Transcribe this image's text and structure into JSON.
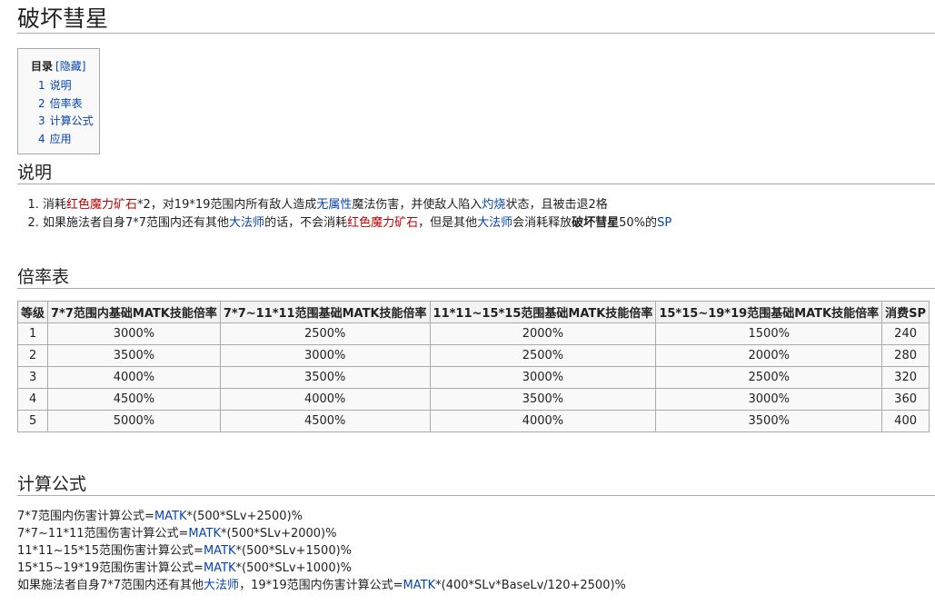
{
  "title": "破坏彗星",
  "toc": {
    "title": "目录",
    "hide_label": "[隐藏]",
    "items": [
      {
        "num": "1",
        "label": "说明"
      },
      {
        "num": "2",
        "label": "倍率表"
      },
      {
        "num": "3",
        "label": "计算公式"
      },
      {
        "num": "4",
        "label": "应用"
      }
    ]
  },
  "section_desc": {
    "heading": "说明",
    "line1": {
      "p1": "消耗",
      "red_ore": "红色魔力矿石",
      "p2": "*2，对19*19范围内所有敌人造成",
      "no_attr": "无属性",
      "p3": "魔法伤害，并使敌人陷入",
      "burn": "灼烧",
      "p4": "状态，且被击退2格"
    },
    "line2": {
      "p1": "如果施法者自身7*7范围内还有其他",
      "wizard1": "大法师",
      "p2": "的话，不会消耗",
      "red_ore": "红色魔力矿石",
      "p3": "，但是其他",
      "wizard2": "大法师",
      "p4": "会消耗释放",
      "skill_bold": "破坏彗星",
      "p5": "50%的",
      "sp": "SP"
    }
  },
  "section_table": {
    "heading": "倍率表",
    "headers": [
      "等级",
      "7*7范围内基础MATK技能倍率",
      "7*7~11*11范围基础MATK技能倍率",
      "11*11~15*15范围基础MATK技能倍率",
      "15*15~19*19范围基础MATK技能倍率",
      "消费SP"
    ],
    "rows": [
      [
        "1",
        "3000%",
        "2500%",
        "2000%",
        "1500%",
        "240"
      ],
      [
        "2",
        "3500%",
        "3000%",
        "2500%",
        "2000%",
        "280"
      ],
      [
        "3",
        "4000%",
        "3500%",
        "3000%",
        "2500%",
        "320"
      ],
      [
        "4",
        "4500%",
        "4000%",
        "3500%",
        "3000%",
        "360"
      ],
      [
        "5",
        "5000%",
        "4500%",
        "4000%",
        "3500%",
        "400"
      ]
    ]
  },
  "section_formula": {
    "heading": "计算公式",
    "lines": [
      {
        "pre": "7*7范围内伤害计算公式=",
        "matk": "MATK",
        "post": "*(500*SLv+2500)%"
      },
      {
        "pre": "7*7~11*11范围伤害计算公式=",
        "matk": "MATK",
        "post": "*(500*SLv+2000)%"
      },
      {
        "pre": "11*11~15*15范围伤害计算公式=",
        "matk": "MATK",
        "post": "*(500*SLv+1500)%"
      },
      {
        "pre": "15*15~19*19范围伤害计算公式=",
        "matk": "MATK",
        "post": "*(500*SLv+1000)%"
      }
    ],
    "last": {
      "p1": "如果施法者自身7*7范围内还有其他",
      "wizard": "大法师",
      "p2": "，19*19范围内伤害计算公式=",
      "matk": "MATK",
      "p3": "*(400*SLv*BaseLv/120+2500)%"
    }
  }
}
